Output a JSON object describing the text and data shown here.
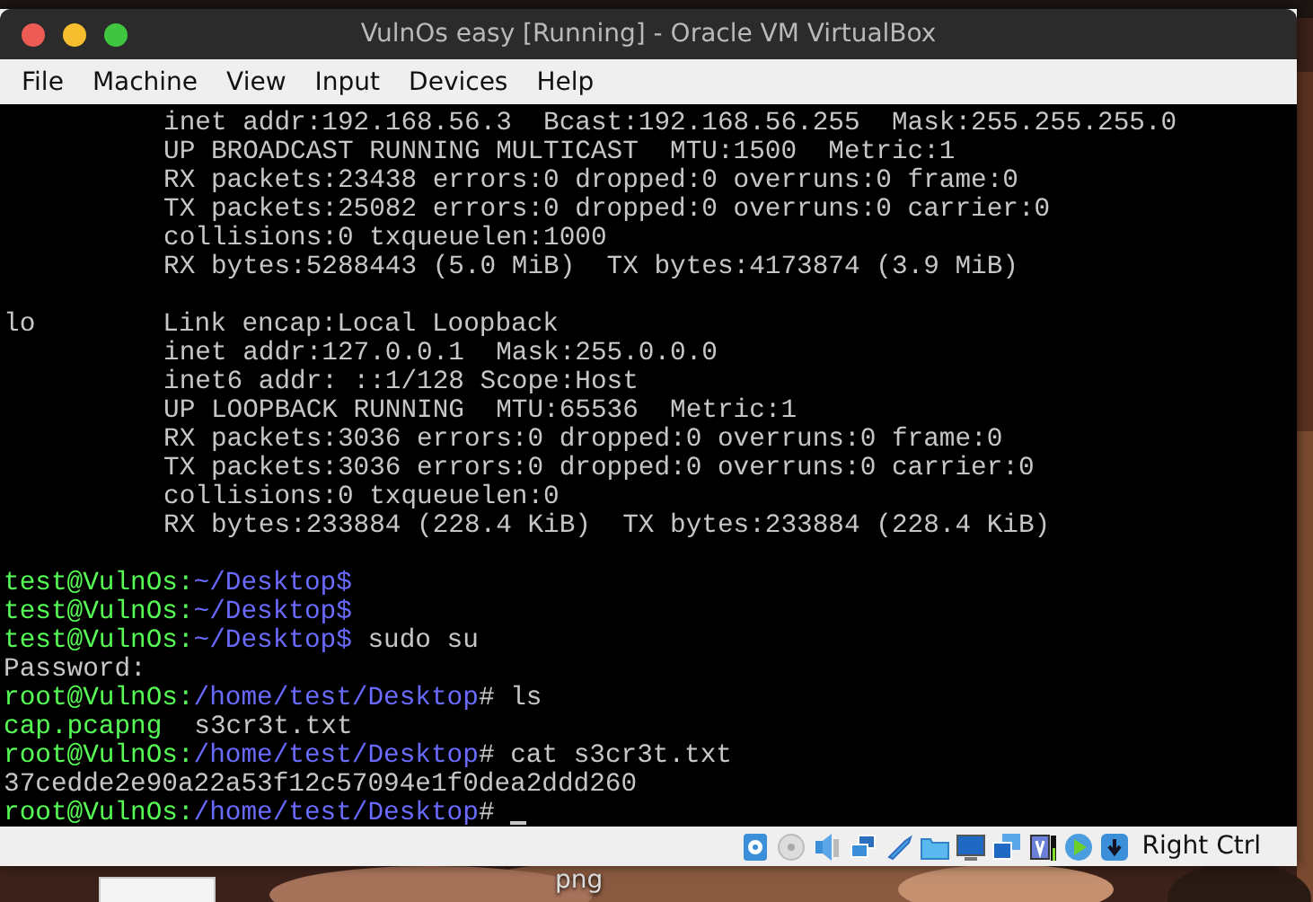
{
  "desktop": {
    "file_label_bottom": "png"
  },
  "window": {
    "title": "VulnOs easy [Running] - Oracle VM VirtualBox"
  },
  "menu": {
    "items": [
      "File",
      "Machine",
      "View",
      "Input",
      "Devices",
      "Help"
    ]
  },
  "terminal": {
    "lines": [
      {
        "kind": "detail",
        "text": "inet addr:192.168.56.3  Bcast:192.168.56.255  Mask:255.255.255.0"
      },
      {
        "kind": "detail",
        "text": "UP BROADCAST RUNNING MULTICAST  MTU:1500  Metric:1"
      },
      {
        "kind": "detail",
        "text": "RX packets:23438 errors:0 dropped:0 overruns:0 frame:0"
      },
      {
        "kind": "detail",
        "text": "TX packets:25082 errors:0 dropped:0 overruns:0 carrier:0"
      },
      {
        "kind": "detail",
        "text": "collisions:0 txqueuelen:1000"
      },
      {
        "kind": "detail",
        "text": "RX bytes:5288443 (5.0 MiB)  TX bytes:4173874 (3.9 MiB)"
      },
      {
        "kind": "blank"
      },
      {
        "kind": "iface",
        "label": "lo",
        "text": "Link encap:Local Loopback"
      },
      {
        "kind": "detail",
        "text": "inet addr:127.0.0.1  Mask:255.0.0.0"
      },
      {
        "kind": "detail",
        "text": "inet6 addr: ::1/128 Scope:Host"
      },
      {
        "kind": "detail",
        "text": "UP LOOPBACK RUNNING  MTU:65536  Metric:1"
      },
      {
        "kind": "detail",
        "text": "RX packets:3036 errors:0 dropped:0 overruns:0 frame:0"
      },
      {
        "kind": "detail",
        "text": "TX packets:3036 errors:0 dropped:0 overruns:0 carrier:0"
      },
      {
        "kind": "detail",
        "text": "collisions:0 txqueuelen:0"
      },
      {
        "kind": "detail",
        "text": "RX bytes:233884 (228.4 KiB)  TX bytes:233884 (228.4 KiB)"
      },
      {
        "kind": "blank"
      },
      {
        "kind": "prompt",
        "user": "test@VulnOs:",
        "path": "~/Desktop$",
        "cursor": false
      },
      {
        "kind": "prompt",
        "user": "test@VulnOs:",
        "path": "~/Desktop$",
        "cursor": false
      },
      {
        "kind": "prompt",
        "user": "test@VulnOs:",
        "path": "~/Desktop$",
        "command": " sudo su",
        "cursor": false
      },
      {
        "kind": "output",
        "text": "Password:"
      },
      {
        "kind": "prompt",
        "user": "root@VulnOs:",
        "path": "/home/test/Desktop",
        "command": "# ls",
        "cursor": false
      },
      {
        "kind": "files",
        "files": [
          {
            "name": "cap.pcapng",
            "color": "#54fc54"
          },
          {
            "name": "s3cr3t.txt",
            "color": "#c6c6c6"
          }
        ]
      },
      {
        "kind": "prompt",
        "user": "root@VulnOs:",
        "path": "/home/test/Desktop",
        "command": "# cat s3cr3t.txt",
        "cursor": false
      },
      {
        "kind": "output",
        "text": "37cedde2e90a22a53f12c57094e1f0dea2ddd260"
      },
      {
        "kind": "prompt",
        "user": "root@VulnOs:",
        "path": "/home/test/Desktop",
        "command": "# ",
        "cursor": true
      }
    ]
  },
  "status_bar": {
    "host_key": "Right Ctrl"
  }
}
